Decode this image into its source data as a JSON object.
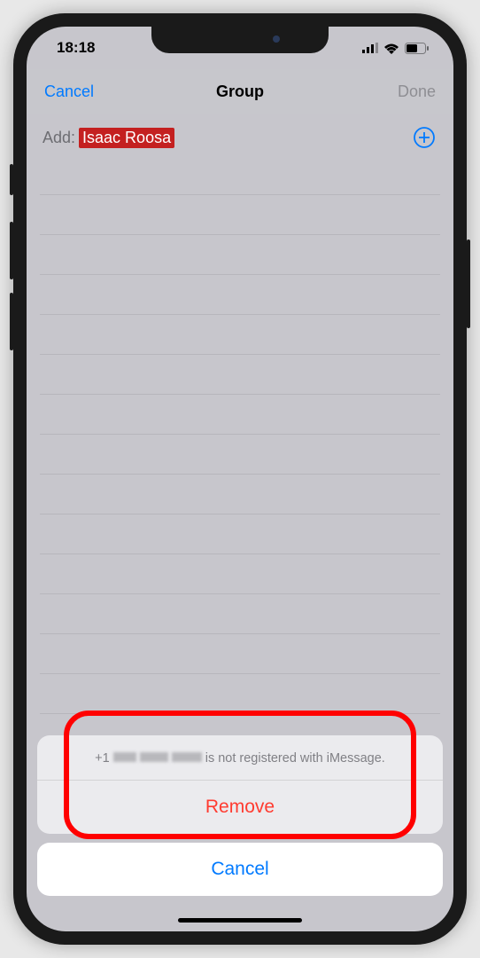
{
  "statusBar": {
    "time": "18:18"
  },
  "nav": {
    "cancel": "Cancel",
    "title": "Group",
    "done": "Done"
  },
  "addContact": {
    "label": "Add:",
    "chipName": "Isaac Roosa"
  },
  "actionSheet": {
    "messagePrefix": "+1",
    "messageSuffix": "is not registered with iMessage.",
    "remove": "Remove",
    "cancel": "Cancel"
  }
}
